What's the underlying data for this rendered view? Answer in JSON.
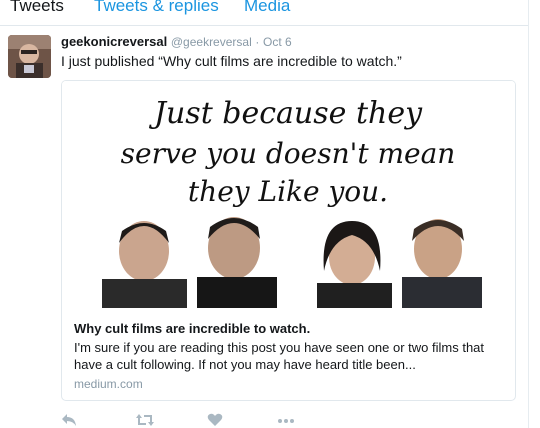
{
  "tabs": {
    "tweets": "Tweets",
    "replies": "Tweets & replies",
    "media": "Media"
  },
  "tweet": {
    "display_name": "geekonicreversal",
    "handle": "@geekreversal",
    "separator": "·",
    "time": "Oct 6",
    "text": "I just published “Why cult films are incredible to watch.”"
  },
  "card": {
    "image_caption_line1": "Just because they",
    "image_caption_line2": "serve you doesn't mean",
    "image_caption_line3": "they Like you.",
    "title": "Why cult films are incredible to watch.",
    "description": "I'm sure if you are reading this post you have seen one or two films that have a cult following. If not you may have heard title been...",
    "domain": "medium.com"
  },
  "actions": {
    "reply_icon": "reply-icon",
    "retweet_icon": "retweet-icon",
    "like_icon": "heart-icon",
    "more_icon": "more-icon"
  },
  "colors": {
    "link_blue": "#1b95e0",
    "muted": "#8899a6",
    "border": "#e1e8ed"
  }
}
